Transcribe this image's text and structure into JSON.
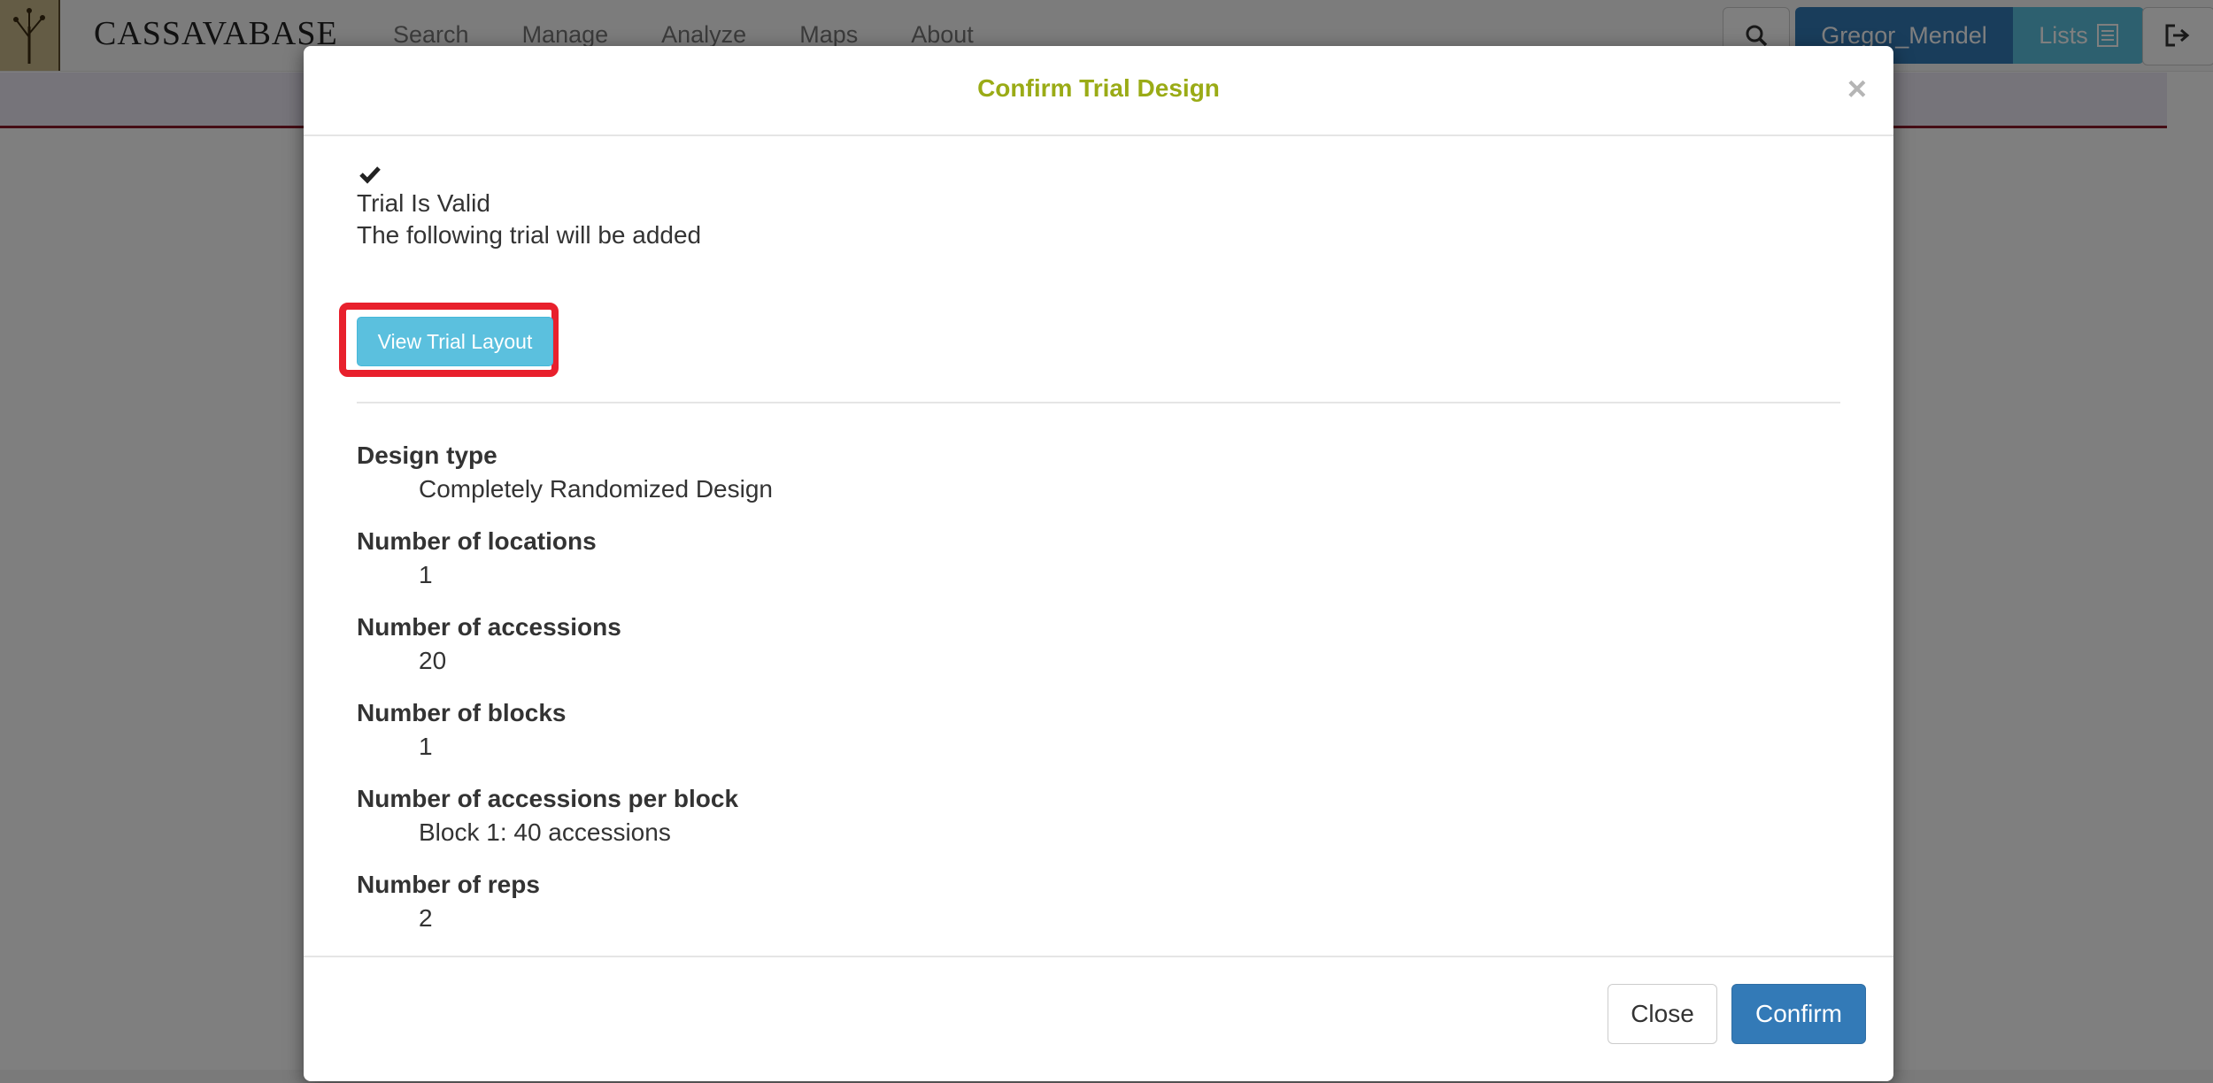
{
  "navbar": {
    "brand": "CASSAVABASE",
    "menu": [
      "Search",
      "Manage",
      "Analyze",
      "Maps",
      "About"
    ],
    "user": "Gregor_Mendel",
    "lists": "Lists"
  },
  "modal": {
    "title": "Confirm Trial Design",
    "close_glyph": "×",
    "status": "Trial Is Valid",
    "message": "The following trial will be added",
    "view_layout_label": "View Trial Layout",
    "details": [
      {
        "label": "Design type",
        "value": "Completely Randomized Design"
      },
      {
        "label": "Number of locations",
        "value": "1"
      },
      {
        "label": "Number of accessions",
        "value": "20"
      },
      {
        "label": "Number of blocks",
        "value": "1"
      },
      {
        "label": "Number of accessions per block",
        "value": "Block 1: 40 accessions"
      },
      {
        "label": "Number of reps",
        "value": "2"
      }
    ],
    "close_label": "Close",
    "confirm_label": "Confirm"
  },
  "colors": {
    "title": "#9aab16",
    "primary": "#337ab7",
    "info": "#5bc0de",
    "highlight": "#e8202c"
  }
}
